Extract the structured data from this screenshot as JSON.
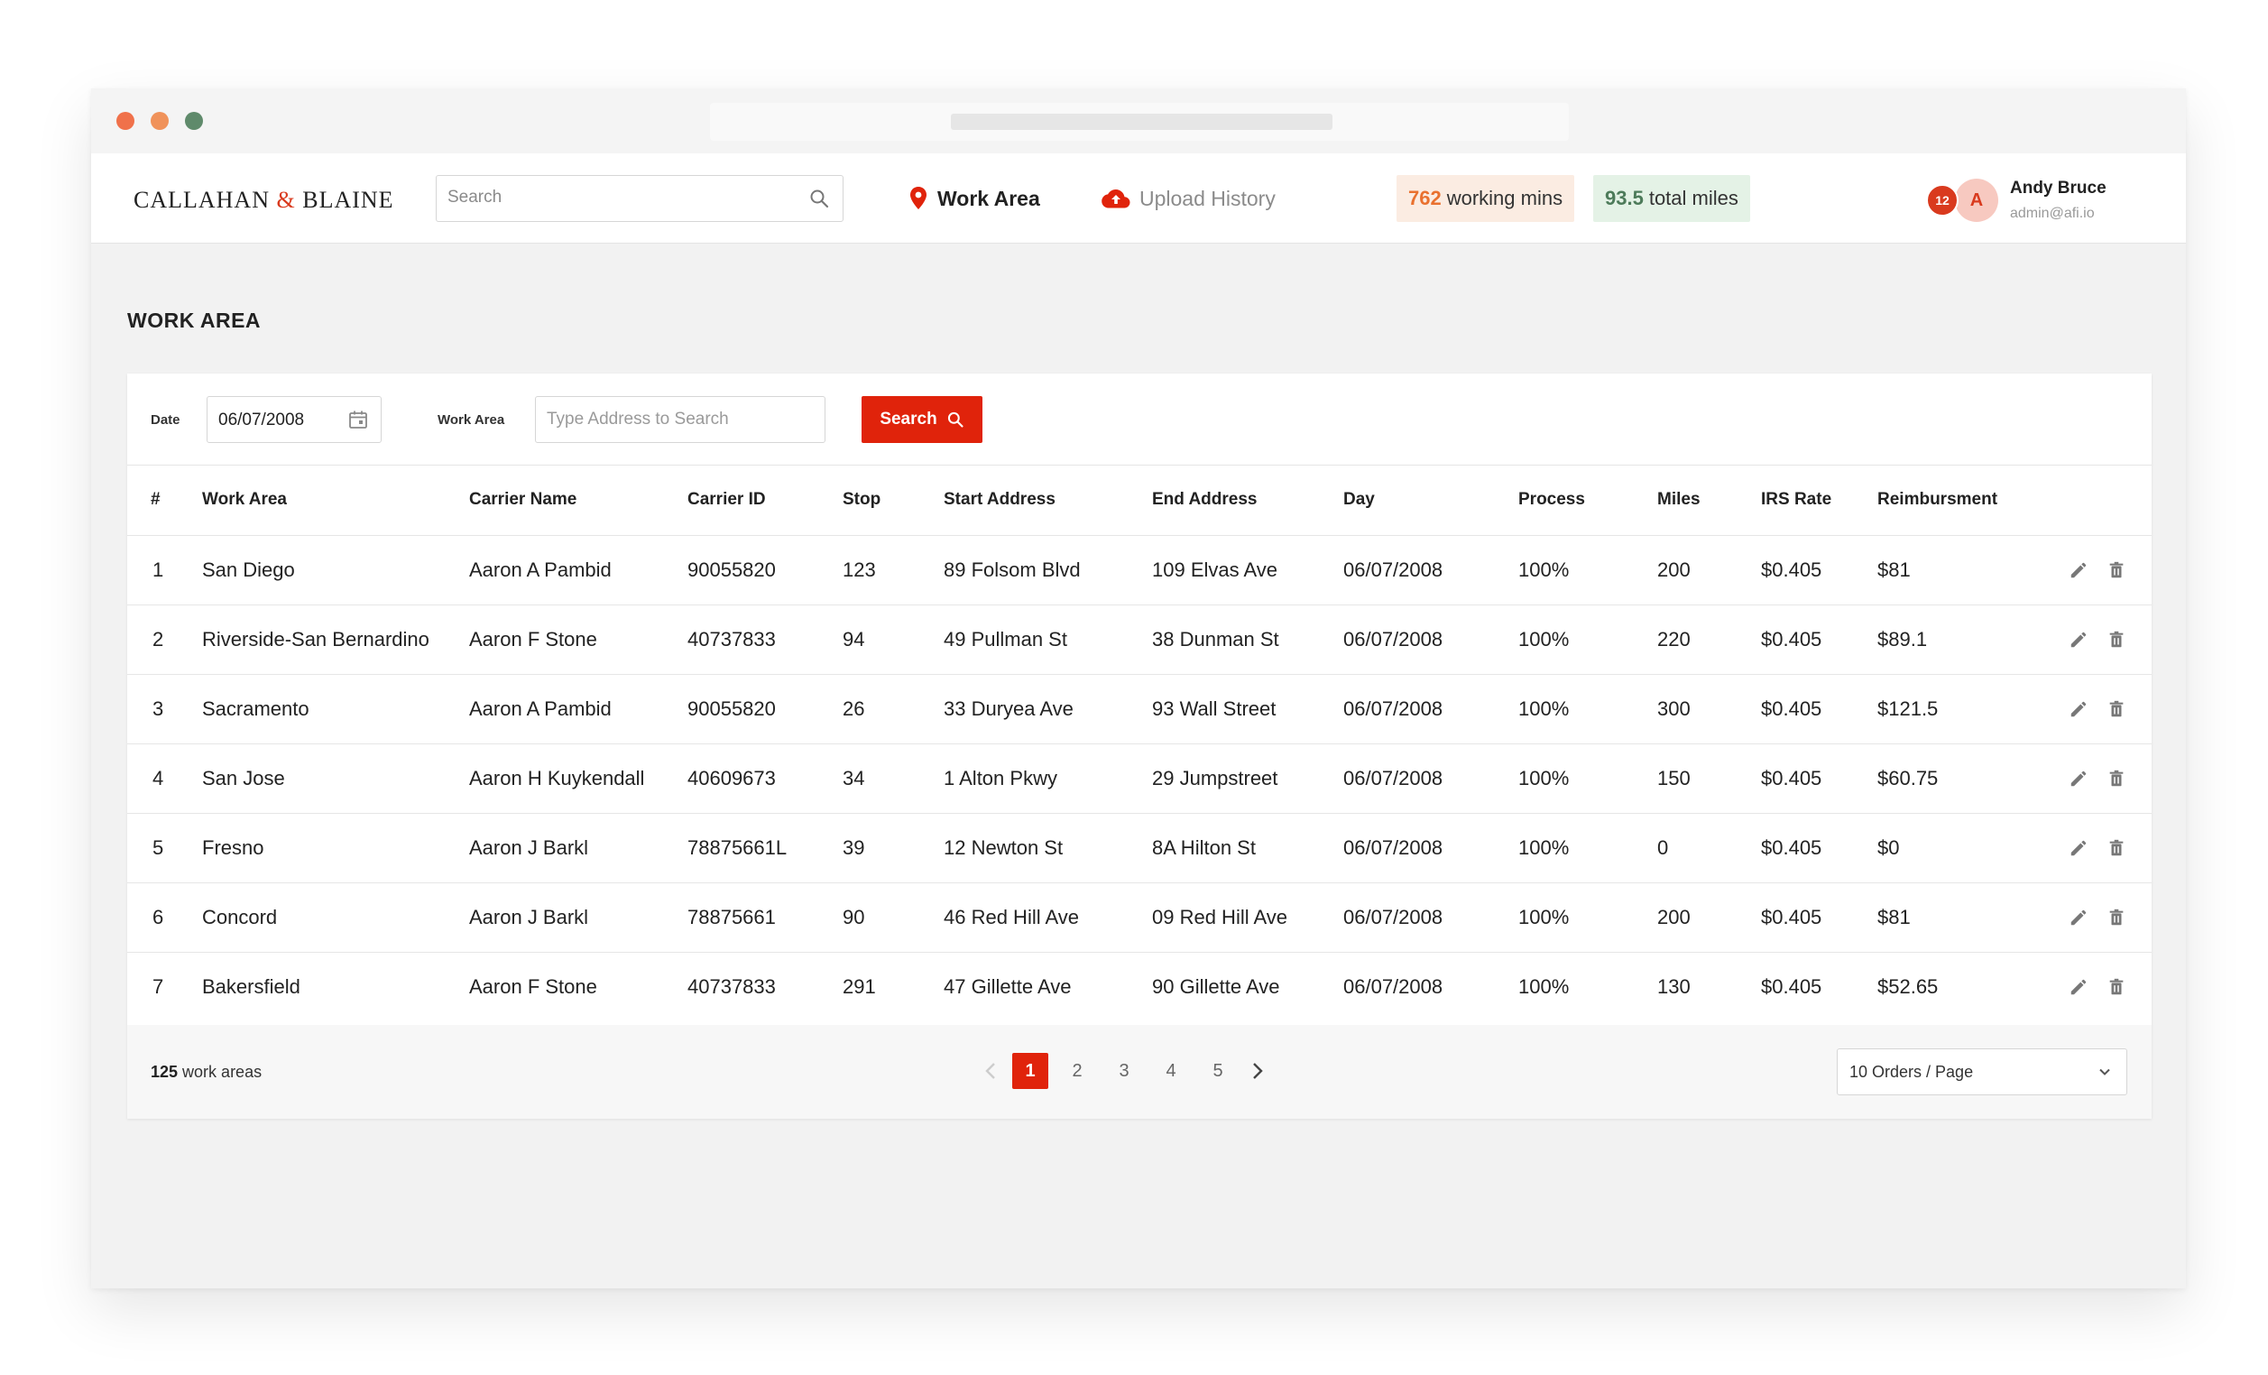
{
  "brand": {
    "name_left": "CALLAHAN ",
    "amp": "&",
    "name_right": " BLAINE"
  },
  "header": {
    "search_placeholder": "Search",
    "nav": [
      {
        "label": "Work Area",
        "icon": "location-pin-icon",
        "active": true
      },
      {
        "label": "Upload History",
        "icon": "cloud-upload-icon",
        "active": false
      }
    ],
    "stats": {
      "mins_value": "762",
      "mins_label": "working mins",
      "miles_value": "93.5",
      "miles_label": "total miles"
    },
    "user": {
      "notifications": "12",
      "initial": "A",
      "name": "Andy Bruce",
      "email": "admin@afi.io"
    }
  },
  "page": {
    "title": "WORK AREA"
  },
  "filters": {
    "date_label": "Date",
    "date_value": "06/07/2008",
    "area_label": "Work Area",
    "area_placeholder": "Type Address to Search",
    "search_button": "Search"
  },
  "table": {
    "columns": [
      "#",
      "Work Area",
      "Carrier Name",
      "Carrier ID",
      "Stop",
      "Start Address",
      "End Address",
      "Day",
      "Process",
      "Miles",
      "IRS Rate",
      "Reimbursment"
    ],
    "rows": [
      [
        "1",
        "San Diego",
        "Aaron A Pambid",
        "90055820",
        "123",
        "89 Folsom Blvd",
        "109 Elvas Ave",
        "06/07/2008",
        "100%",
        "200",
        "$0.405",
        "$81"
      ],
      [
        "2",
        "Riverside-San Bernardino",
        "Aaron F Stone",
        "40737833",
        "94",
        "49 Pullman St",
        "38 Dunman St",
        "06/07/2008",
        "100%",
        "220",
        "$0.405",
        "$89.1"
      ],
      [
        "3",
        "Sacramento",
        "Aaron A Pambid",
        "90055820",
        "26",
        "33 Duryea Ave",
        "93 Wall Street",
        "06/07/2008",
        "100%",
        "300",
        "$0.405",
        "$121.5"
      ],
      [
        "4",
        "San Jose",
        "Aaron H Kuykendall",
        "40609673",
        "34",
        "1 Alton Pkwy",
        "29 Jumpstreet",
        "06/07/2008",
        "100%",
        "150",
        "$0.405",
        "$60.75"
      ],
      [
        "5",
        "Fresno",
        "Aaron J Barkl",
        "78875661L",
        "39",
        "12 Newton St",
        "8A Hilton St",
        "06/07/2008",
        "100%",
        "0",
        "$0.405",
        "$0"
      ],
      [
        "6",
        "Concord",
        "Aaron J Barkl",
        "78875661",
        "90",
        "46 Red Hill Ave",
        "09 Red Hill Ave",
        "06/07/2008",
        "100%",
        "200",
        "$0.405",
        "$81"
      ],
      [
        "7",
        "Bakersfield",
        "Aaron F Stone",
        "40737833",
        "291",
        "47 Gillette Ave",
        "90 Gillette Ave",
        "06/07/2008",
        "100%",
        "130",
        "$0.405",
        "$52.65"
      ]
    ]
  },
  "footer": {
    "count_value": "125",
    "count_label": " work areas",
    "pages": [
      "1",
      "2",
      "3",
      "4",
      "5"
    ],
    "current_page": "1",
    "per_page": "10 Orders / Page"
  },
  "colors": {
    "accent": "#e0230b",
    "mins_bg": "#fbece2",
    "mins_text": "#e9712f",
    "miles_bg": "#e4f2e6",
    "miles_text": "#4d7b5a"
  }
}
